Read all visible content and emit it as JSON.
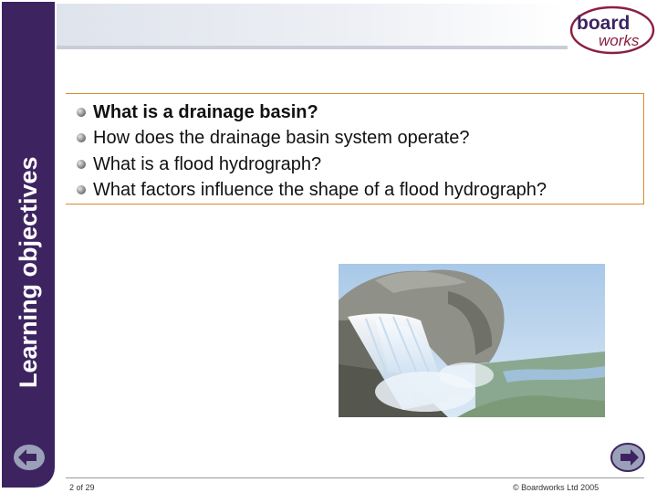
{
  "sidebar": {
    "title": "Learning objectives"
  },
  "logo": {
    "line1": "board",
    "line2": "works"
  },
  "objectives": [
    {
      "text": "What is a drainage basin?",
      "bold": true
    },
    {
      "text": "How does the drainage basin system operate?",
      "bold": false
    },
    {
      "text": "What is a flood hydrograph?",
      "bold": false
    },
    {
      "text": "What factors influence the shape of a flood hydrograph?",
      "bold": false
    }
  ],
  "footer": {
    "page": "2 of 29",
    "copyright": "© Boardworks Ltd 2005"
  },
  "colors": {
    "sidebar": "#3d2461",
    "accent_border": "#d98a2e",
    "logo_ring": "#8b1f3f"
  },
  "icons": {
    "prev": "back-arrow-icon",
    "next": "forward-arrow-icon"
  }
}
